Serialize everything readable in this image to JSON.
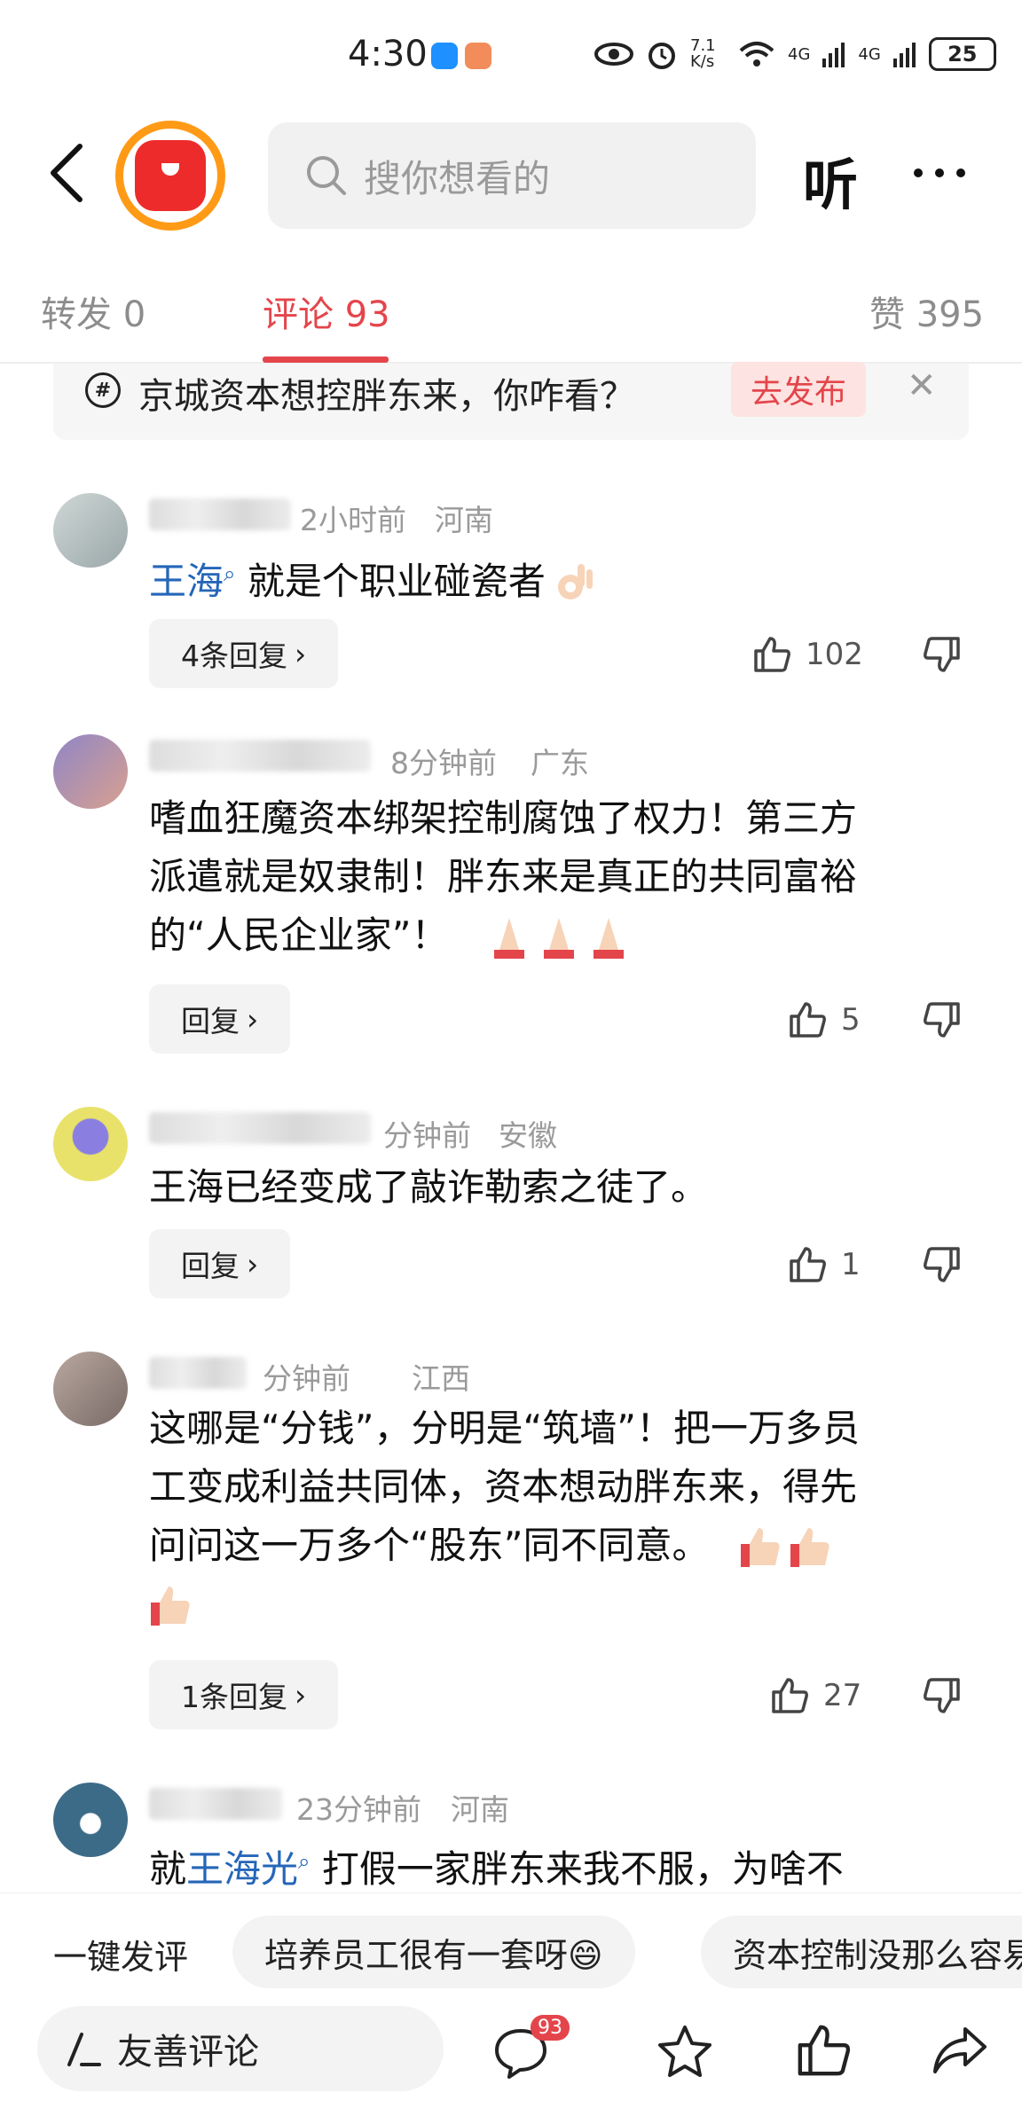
{
  "status_bar": {
    "time": "4:30",
    "net_speed": "7.1 K/s",
    "signal_a": "4G",
    "signal_b": "4G",
    "battery": "25"
  },
  "header": {
    "search_placeholder": "搜你想看的",
    "listen_label": "听"
  },
  "tabs": [
    {
      "label": "转发 0",
      "active": false
    },
    {
      "label": "评论 93",
      "active": true
    },
    {
      "label": "赞 395",
      "active": false
    }
  ],
  "topic": {
    "text": "京城资本想控胖东来，你咋看？",
    "button": "去发布"
  },
  "comments": [
    {
      "time": "2小时前",
      "location": "河南",
      "mention": "王海",
      "text": "就是个职业碰瓷者",
      "reply_label": "4条回复",
      "likes": "102"
    },
    {
      "time": "8分钟前",
      "location": "广东",
      "text_lines": [
        "嗜血狂魔资本绑架控制腐蚀了权力！第三方",
        "派遣就是奴隶制！胖东来是真正的共同富裕",
        "的“人民企业家”！"
      ],
      "reply_label": "回复",
      "likes": "5"
    },
    {
      "time": "分钟前",
      "location": "安徽",
      "text": "王海已经变成了敲诈勒索之徒了。",
      "reply_label": "回复",
      "likes": "1"
    },
    {
      "time": "分钟前",
      "location": "江西",
      "text_lines": [
        "这哪是“分钱”，分明是“筑墙”！把一万多员",
        "工变成利益共同体，资本想动胖东来，得先",
        "问问这一万多个“股东”同不同意。"
      ],
      "reply_label": "1条回复",
      "likes": "27"
    },
    {
      "time": "23分钟前",
      "location": "河南",
      "prefix": "就",
      "mention": "王海光",
      "text": "打假一家胖东来我不服，为啥不"
    }
  ],
  "quick_reply": {
    "label": "一键发评",
    "chips": [
      "培养员工很有一套呀😄",
      "资本控制没那么容易"
    ]
  },
  "bottom_bar": {
    "input_placeholder": "友善评论",
    "comment_count": "93"
  },
  "colors": {
    "accent": "#e4454b",
    "mention": "#2566b8",
    "meta": "#9a9a9a"
  }
}
